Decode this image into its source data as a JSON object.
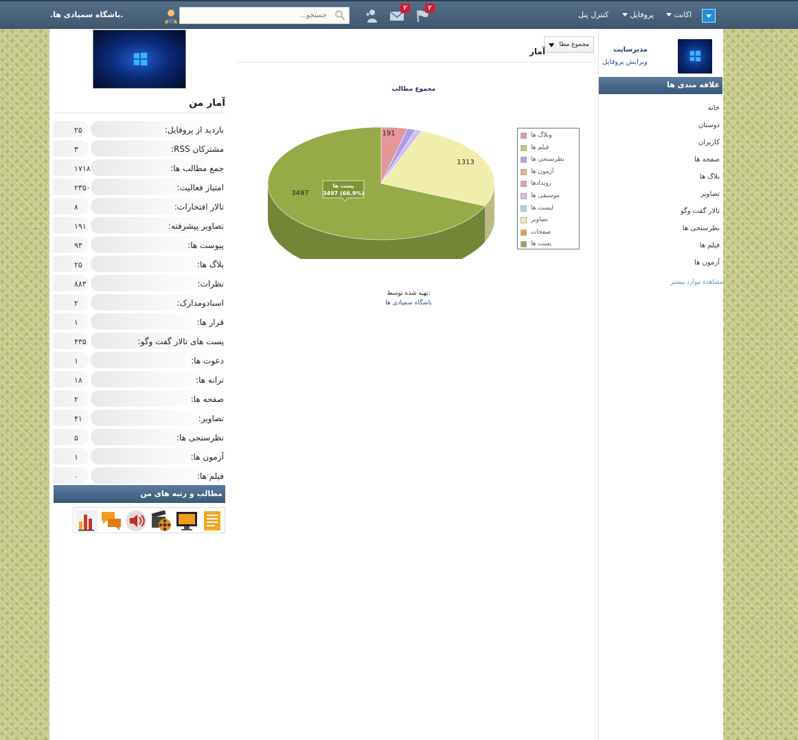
{
  "topbar": {
    "menu_icon": "menu-dropdown-icon",
    "account_label": "اکانت",
    "profile_label": "پروفایل",
    "control_panel_label": "کنترل پنل",
    "flags_badge": "۲",
    "messages_badge": "۲",
    "search_placeholder": "جستجو...",
    "site_name": ".باشگاه سمپادی ها."
  },
  "right_sidebar": {
    "user_name": "مدیرسایت",
    "edit_profile": "ویرایش پروفایل",
    "interests_title": "علاقه مندی ها",
    "nav": [
      "خانه",
      "دوستان",
      "کاربران",
      "صفحه ها",
      "بلاگ ها",
      "تصاویر",
      "تالار گفت وگو",
      "نظرسنجی ها",
      "فیلم ها",
      "آزمون ها"
    ],
    "more": "مشاهده موارد بیشتر"
  },
  "center": {
    "title": "آمار",
    "dropdown_value": "مجموع مطا",
    "credit_label": "تهیه شده توسط:",
    "credit_link": "باشگاه سمپادی ها"
  },
  "chart_data": {
    "type": "pie",
    "title": "مجموع مطالب",
    "slices": [
      {
        "name": "وبلاگ ها",
        "value": 191,
        "color": "#e3979a"
      },
      {
        "name": "فیلم ها",
        "value": 0,
        "color": "#b8cd72"
      },
      {
        "name": "نظرسنجی ها",
        "value": 60,
        "color": "#a6a0ec"
      },
      {
        "name": "آزمون ها",
        "value": 0,
        "color": "#f0b07b"
      },
      {
        "name": "رویدادها",
        "value": 0,
        "color": "#e7a0a6"
      },
      {
        "name": "موسیقی ها",
        "value": 48,
        "color": "#d8bdeb"
      },
      {
        "name": "لیست ها",
        "value": 0,
        "color": "#a9d8ea"
      },
      {
        "name": "تصاویر",
        "value": 1313,
        "color": "#f0eeaa"
      },
      {
        "name": "صفحات",
        "value": 0,
        "color": "#f29a3e"
      },
      {
        "name": "پست ها",
        "value": 3497,
        "color": "#96ab48"
      }
    ],
    "labels": [
      "191",
      "1313",
      "3497"
    ],
    "tooltip_title": "پست ها",
    "tooltip_value": "3497 (66.9%)",
    "legend_position": "right"
  },
  "left": {
    "stats_title": "آمار من",
    "stats": [
      {
        "label": "بازدید از پروفایل:",
        "value": "۲۵"
      },
      {
        "label": "مشترکان RSS:",
        "value": "۳"
      },
      {
        "label": "جمع مطالب ها:",
        "value": "۱۷۱۸"
      },
      {
        "label": "امتیاز فعالیت:",
        "value": "۲۳۵۰"
      },
      {
        "label": "تالار افتخارات:",
        "value": "۸"
      },
      {
        "label": "تصاویر پیشرفته:",
        "value": "۱۹۱"
      },
      {
        "label": "پیوست ها:",
        "value": "۹۳"
      },
      {
        "label": "بلاگ ها:",
        "value": "۲۵"
      },
      {
        "label": "نظرات:",
        "value": "۸۸۳"
      },
      {
        "label": "اسنادومدارک:",
        "value": "۲"
      },
      {
        "label": "قرار ها:",
        "value": "۱"
      },
      {
        "label": "پست های تالار گفت وگو:",
        "value": "۴۳۵"
      },
      {
        "label": "دعوت ها:",
        "value": "۱"
      },
      {
        "label": "ترانه ها:",
        "value": "۱۸"
      },
      {
        "label": "صفحه ها:",
        "value": "۲"
      },
      {
        "label": "تصاویر:",
        "value": "۴۱"
      },
      {
        "label": "نظرسنجی ها:",
        "value": "۵"
      },
      {
        "label": "آزمون ها:",
        "value": "۱"
      },
      {
        "label": "فیلم ها:",
        "value": "۰"
      }
    ],
    "my_items_title": "مطالب و رتبه های من",
    "my_items_icons": [
      "bar-chart-icon",
      "speech-bubble-icon",
      "speaker-icon",
      "film-reel-icon",
      "monitor-icon",
      "document-icon"
    ]
  }
}
